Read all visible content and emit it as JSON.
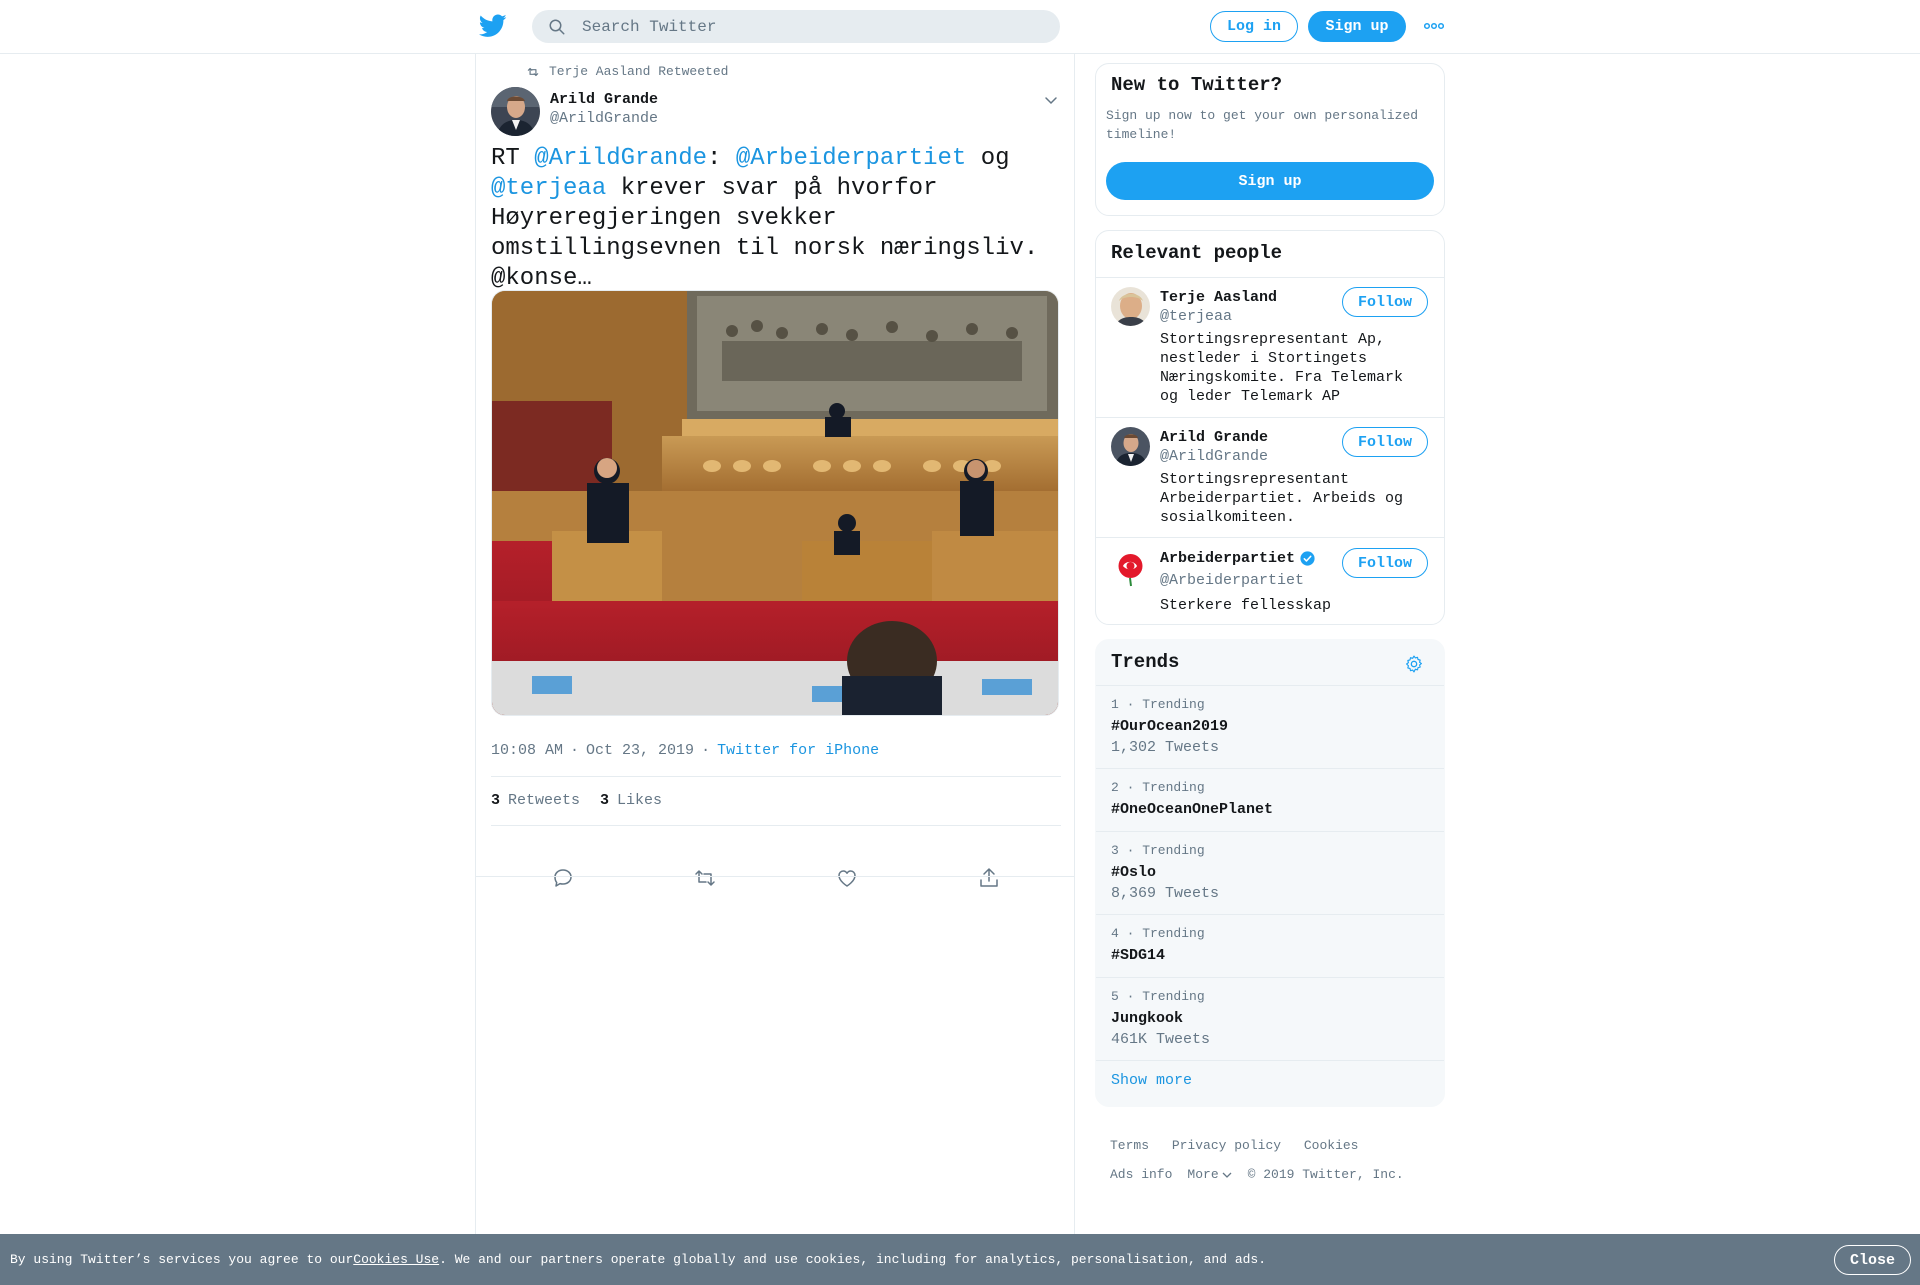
{
  "header": {
    "search_placeholder": "Search Twitter",
    "login_label": "Log in",
    "signup_label": "Sign up"
  },
  "tweet": {
    "retweet_context": "Terje Aasland Retweeted",
    "author_name": "Arild Grande",
    "author_handle": "@ArildGrande",
    "text_parts": {
      "p1": "RT ",
      "m1": "@ArildGrande",
      "p2": ": ",
      "m2": "@Arbeiderpartiet",
      "p3": " og\n",
      "m3": "@terjeaa",
      "p4": " krever svar på hvorfor Høyreregjeringen svekker omstillingsevnen til norsk næringsliv. @konse…"
    },
    "time": "10:08 AM",
    "date": "Oct 23, 2019",
    "source": "Twitter for iPhone",
    "retweets_count": "3",
    "retweets_label": "Retweets",
    "likes_count": "3",
    "likes_label": "Likes"
  },
  "new_to_twitter": {
    "title": "New to Twitter?",
    "description": "Sign up now to get your own personalized timeline!",
    "signup_label": "Sign up"
  },
  "relevant_people": {
    "title": "Relevant people",
    "people": [
      {
        "name": "Terje Aasland",
        "handle": "@terjeaa",
        "bio": "Stortingsrepresentant Ap, nestleder i Stortingets Næringskomite. Fra Telemark og leder Telemark AP",
        "follow_label": "Follow",
        "verified": false
      },
      {
        "name": "Arild Grande",
        "handle": "@ArildGrande",
        "bio": "Stortingsrepresentant Arbeiderpartiet. Arbeids og sosialkomiteen.",
        "follow_label": "Follow",
        "verified": false
      },
      {
        "name": "Arbeiderpartiet",
        "handle": "@Arbeiderpartiet",
        "bio": "Sterkere fellesskap",
        "follow_label": "Follow",
        "verified": true
      }
    ]
  },
  "trends": {
    "title": "Trends",
    "items": [
      {
        "meta": "1 · Trending",
        "name": "#OurOcean2019",
        "count": "1,302 Tweets"
      },
      {
        "meta": "2 · Trending",
        "name": "#OneOceanOnePlanet",
        "count": ""
      },
      {
        "meta": "3 · Trending",
        "name": "#Oslo",
        "count": "8,369 Tweets"
      },
      {
        "meta": "4 · Trending",
        "name": "#SDG14",
        "count": ""
      },
      {
        "meta": "5 · Trending",
        "name": "Jungkook",
        "count": "461K Tweets"
      }
    ],
    "show_more": "Show more"
  },
  "footer": {
    "terms": "Terms",
    "privacy": "Privacy policy",
    "cookies": "Cookies",
    "ads_info": "Ads info",
    "more": "More",
    "copyright": "© 2019 Twitter, Inc."
  },
  "cookie_bar": {
    "text_before": "By using Twitter’s services you agree to our ",
    "link": "Cookies Use",
    "text_after": ". We and our partners operate globally and use cookies, including for analytics, personalisation, and ads.",
    "close_label": "Close"
  },
  "colors": {
    "brand": "#1da1f2",
    "link": "#1b95e0",
    "secondary_text": "#657786",
    "border": "#e6ecf0",
    "cookie_bar_bg": "#657786",
    "ap_red": "#e3192b"
  },
  "icons": [
    "twitter-bird-icon",
    "search-icon",
    "more-dots-icon",
    "retweet-icon",
    "chevron-down-icon",
    "reply-icon",
    "like-icon",
    "share-icon",
    "verified-badge-icon",
    "gear-icon"
  ]
}
